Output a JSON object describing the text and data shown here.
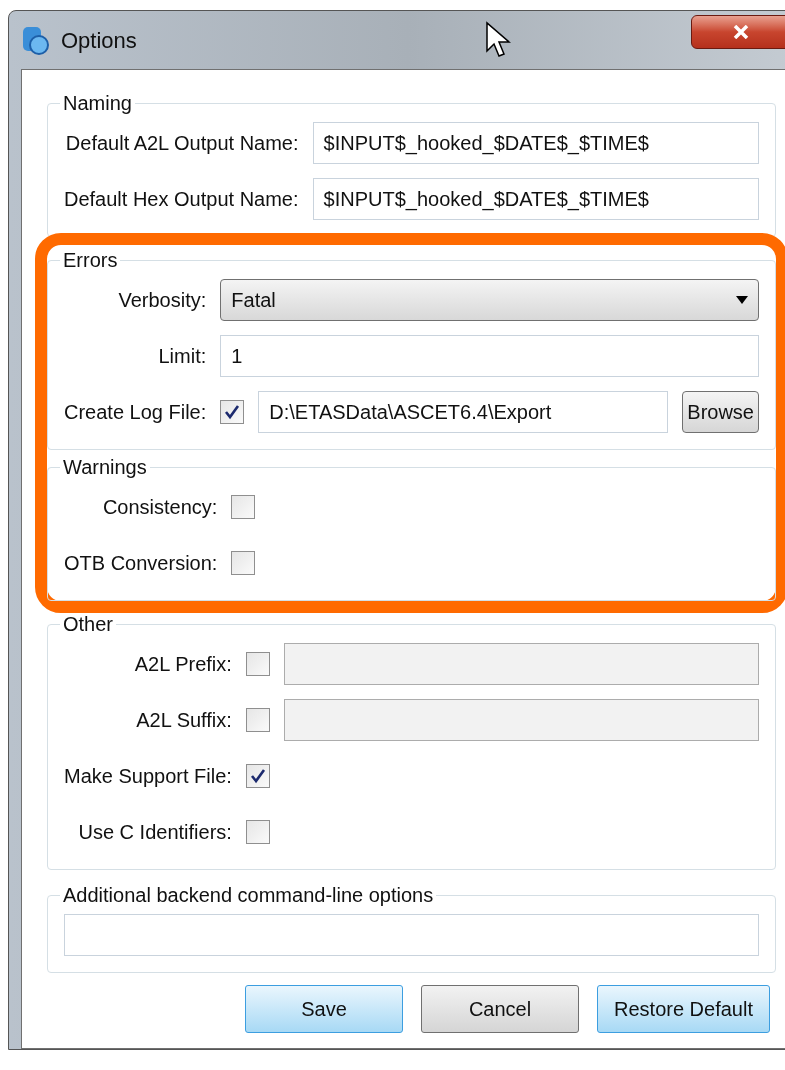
{
  "window": {
    "title": "Options"
  },
  "groups": [
    {
      "title": "Naming",
      "highlighted": false,
      "rows": [
        {
          "kind": "text",
          "label": "Default A2L Output Name:",
          "value": "$INPUT$_hooked_$DATE$_$TIME$"
        },
        {
          "kind": "text",
          "label": "Default Hex Output Name:",
          "value": "$INPUT$_hooked_$DATE$_$TIME$"
        }
      ]
    },
    {
      "title": "Errors",
      "highlighted": true,
      "rows": [
        {
          "kind": "dropdown",
          "label": "Verbosity:",
          "value": "Fatal"
        },
        {
          "kind": "text",
          "label": "Limit:",
          "value": "1"
        },
        {
          "kind": "checkbox_path",
          "label": "Create Log File:",
          "checked": true,
          "value": "D:\\ETASData\\ASCET6.4\\Export",
          "button": "Browse"
        }
      ]
    },
    {
      "title": "Warnings",
      "highlighted": true,
      "rows": [
        {
          "kind": "checkbox",
          "label": "Consistency:",
          "checked": false
        },
        {
          "kind": "checkbox",
          "label": "OTB Conversion:",
          "checked": false
        }
      ]
    },
    {
      "title": "Other",
      "highlighted": false,
      "rows": [
        {
          "kind": "checkbox_text",
          "label": "A2L Prefix:",
          "checked": false,
          "disabled": true
        },
        {
          "kind": "checkbox_text",
          "label": "A2L Suffix:",
          "checked": false,
          "disabled": true
        },
        {
          "kind": "checkbox",
          "label": "Make Support File:",
          "checked": true
        },
        {
          "kind": "checkbox",
          "label": "Use C Identifiers:",
          "checked": false
        }
      ]
    },
    {
      "title": "Additional backend command-line options",
      "highlighted": false,
      "rows": [
        {
          "kind": "wide_text"
        }
      ]
    }
  ],
  "buttons": [
    {
      "label": "Save",
      "default": true
    },
    {
      "label": "Cancel",
      "default": false
    },
    {
      "label": "Restore Default",
      "default": true
    }
  ]
}
